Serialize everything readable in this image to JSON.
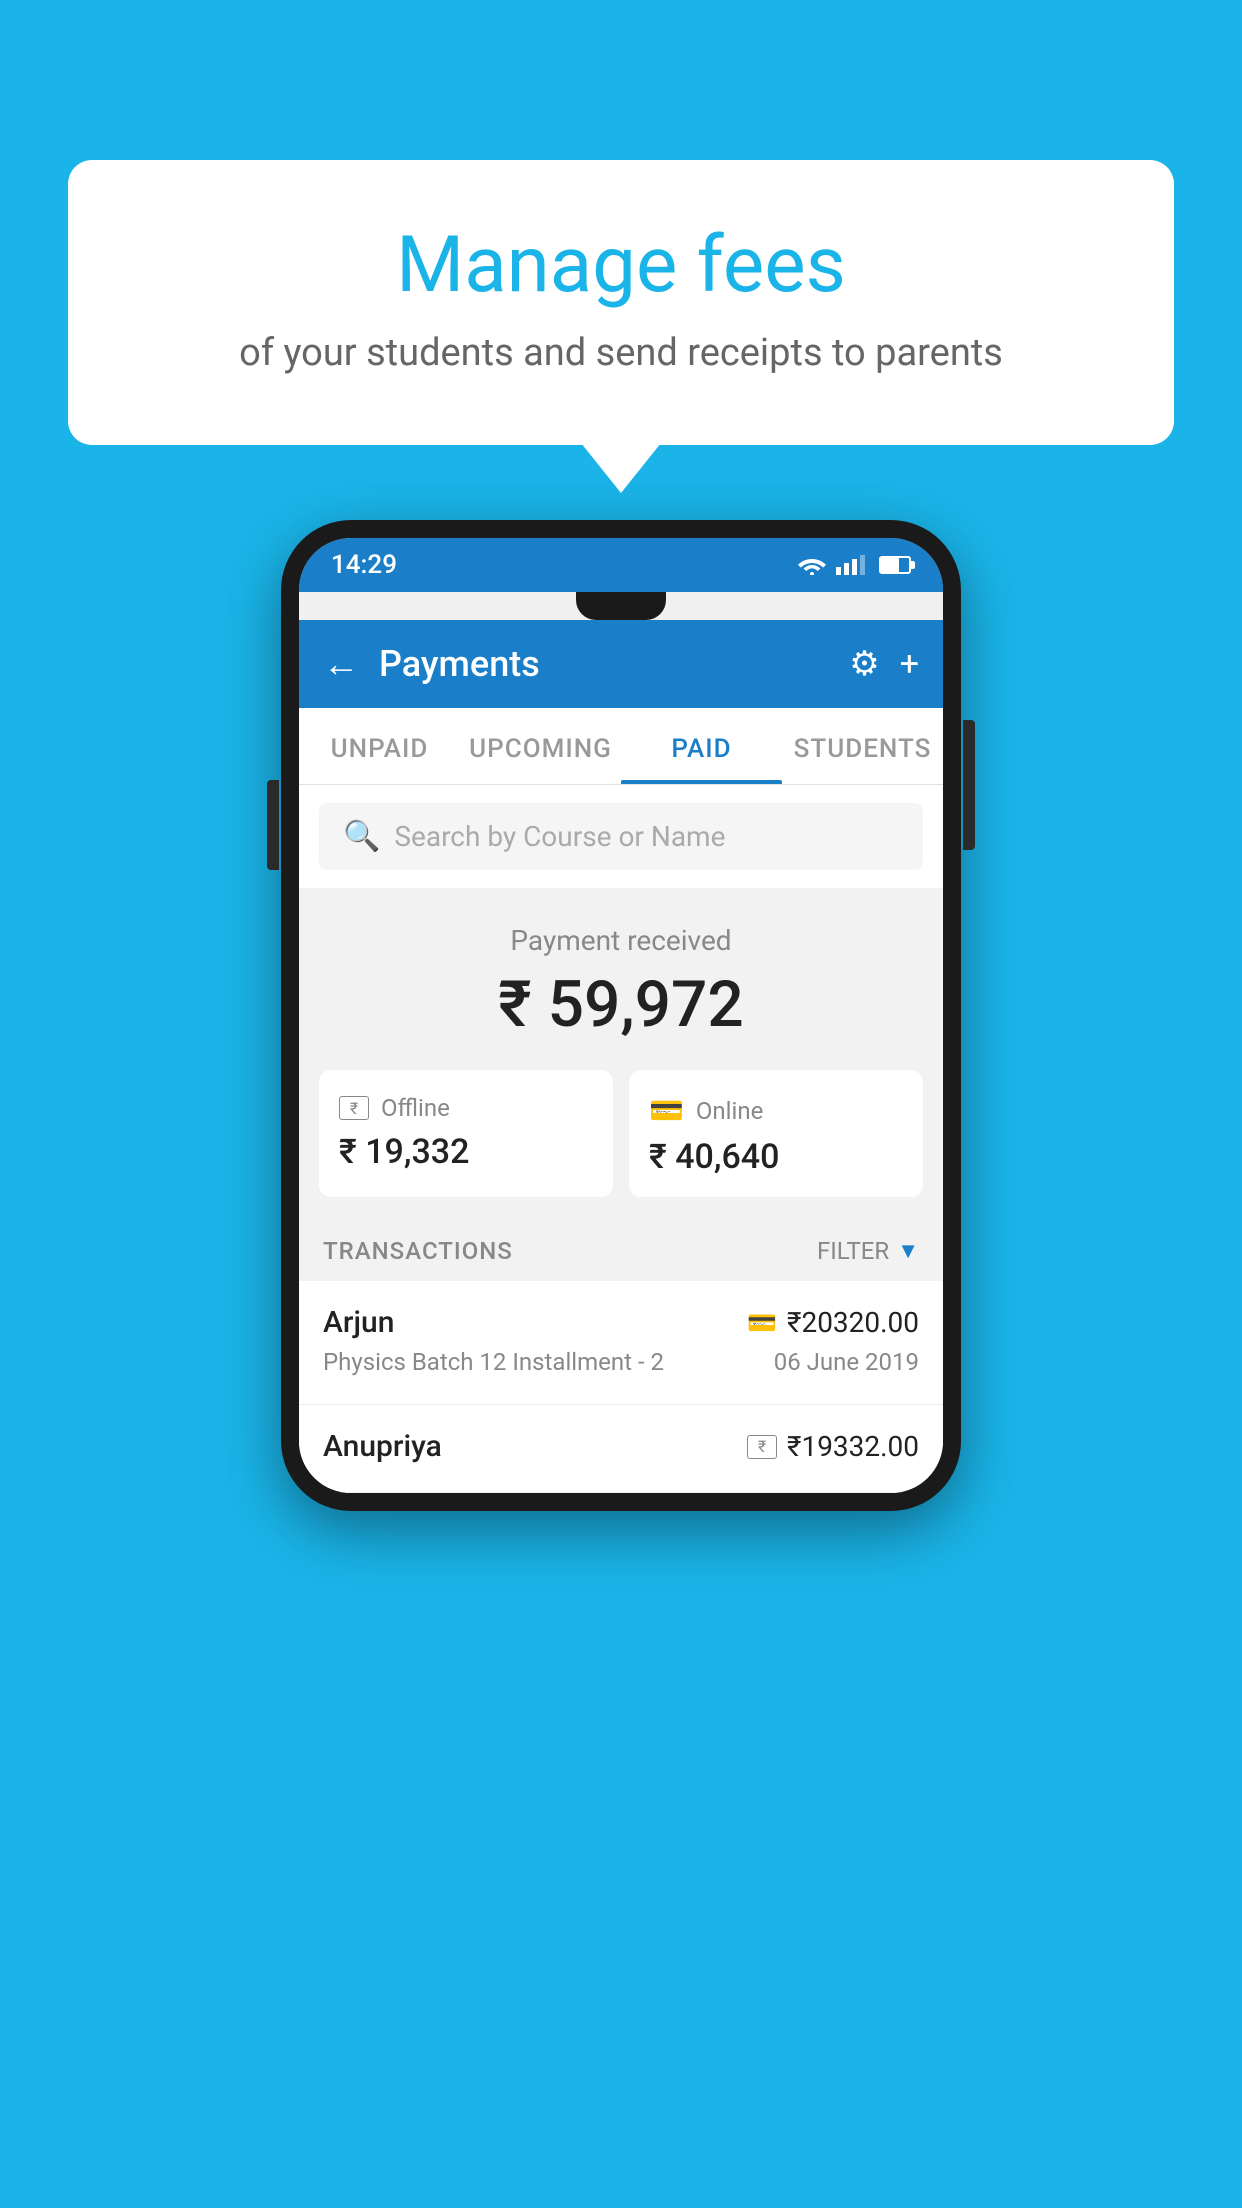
{
  "background_color": "#1ab4e8",
  "speech_bubble": {
    "title": "Manage fees",
    "subtitle": "of your students and send receipts to parents"
  },
  "status_bar": {
    "time": "14:29"
  },
  "app_bar": {
    "title": "Payments",
    "back_label": "←",
    "gear_label": "⚙",
    "plus_label": "+"
  },
  "tabs": [
    {
      "label": "UNPAID",
      "active": false
    },
    {
      "label": "UPCOMING",
      "active": false
    },
    {
      "label": "PAID",
      "active": true
    },
    {
      "label": "STUDENTS",
      "active": false
    }
  ],
  "search": {
    "placeholder": "Search by Course or Name"
  },
  "payment_received": {
    "label": "Payment received",
    "amount": "₹ 59,972"
  },
  "payment_cards": [
    {
      "icon": "rupee-box",
      "label": "Offline",
      "amount": "₹ 19,332"
    },
    {
      "icon": "card",
      "label": "Online",
      "amount": "₹ 40,640"
    }
  ],
  "transactions_section": {
    "label": "TRANSACTIONS",
    "filter_label": "FILTER"
  },
  "transactions": [
    {
      "name": "Arjun",
      "icon_type": "card",
      "amount": "₹20320.00",
      "detail": "Physics Batch 12 Installment - 2",
      "date": "06 June 2019"
    },
    {
      "name": "Anupriya",
      "icon_type": "rupee-box",
      "amount": "₹19332.00",
      "detail": "",
      "date": ""
    }
  ]
}
